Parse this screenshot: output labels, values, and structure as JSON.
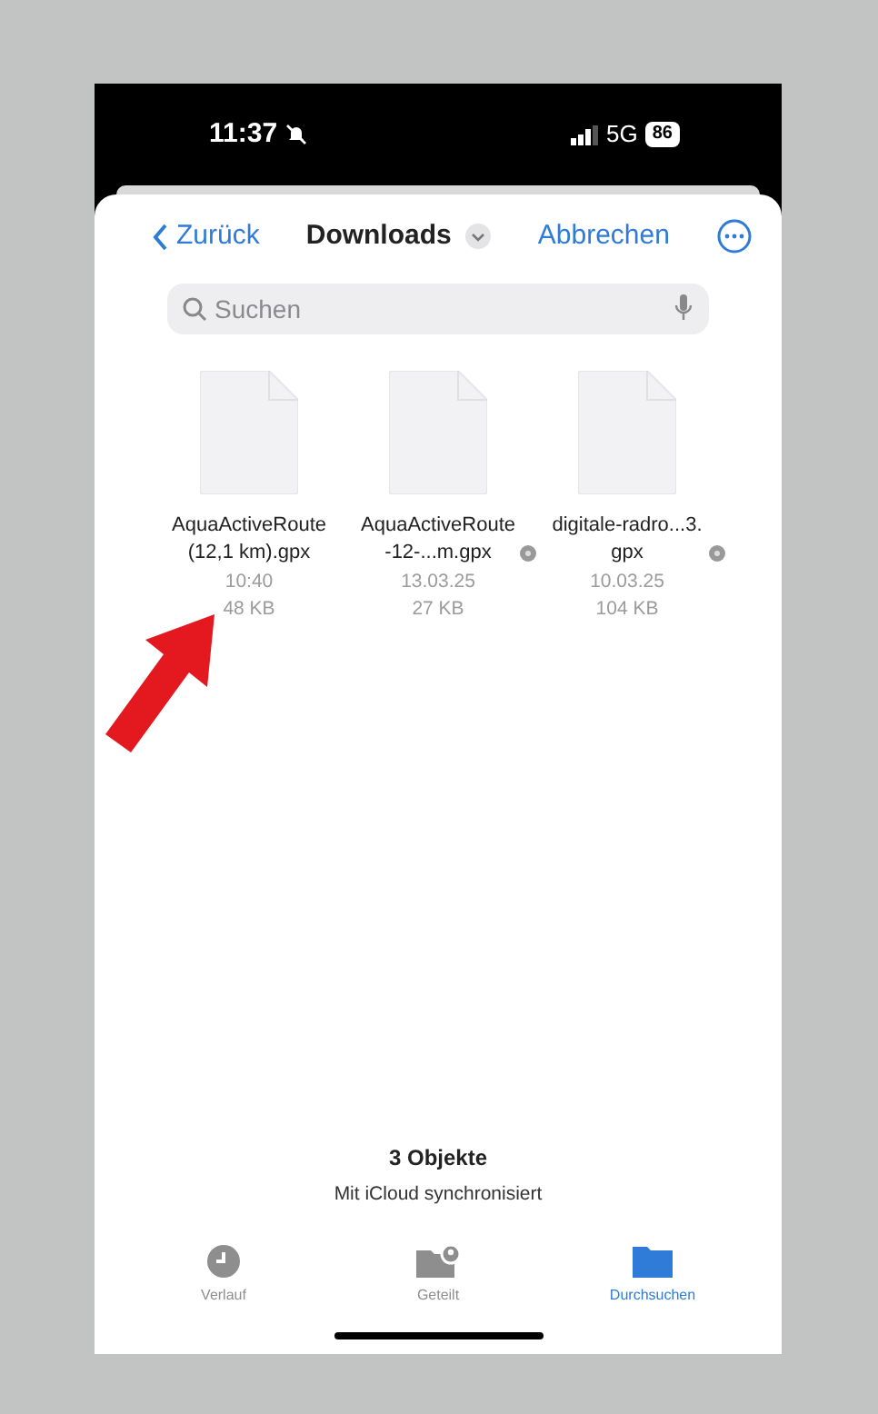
{
  "status_bar": {
    "time": "11:37",
    "network": "5G",
    "battery": "86"
  },
  "nav": {
    "back": "Zurück",
    "title": "Downloads",
    "cancel": "Abbrechen"
  },
  "search": {
    "placeholder": "Suchen"
  },
  "files": [
    {
      "name": "AquaActiveRoute (12,1 km).gpx",
      "date": "10:40",
      "size": "48 KB",
      "icloud": false
    },
    {
      "name": "AquaActiveRoute-12-...m.gpx",
      "date": "13.03.25",
      "size": "27 KB",
      "icloud": true
    },
    {
      "name": "digitale-radro...3.gpx",
      "date": "10.03.25",
      "size": "104 KB",
      "icloud": true
    }
  ],
  "footer": {
    "count": "3 Objekte",
    "sync": "Mit iCloud synchronisiert"
  },
  "tabs": [
    {
      "kind": "clock",
      "label": "Verlauf",
      "selected": false
    },
    {
      "kind": "shared",
      "label": "Geteilt",
      "selected": false
    },
    {
      "kind": "folder",
      "label": "Durchsuchen",
      "selected": true
    }
  ]
}
